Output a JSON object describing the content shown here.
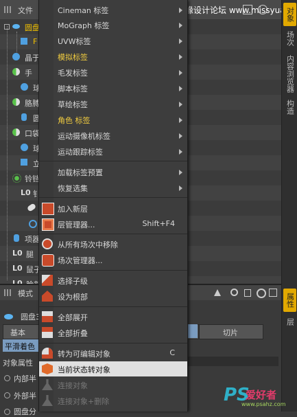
{
  "header": {
    "file_menu": "文件"
  },
  "watermark": {
    "top": "思缘设计论坛 www.missyuan.com",
    "ps": "PS",
    "zh": "爱好者",
    "url": "www.psahz.com"
  },
  "tree": {
    "rows": [
      {
        "label": "圆盘",
        "selected": true
      },
      {
        "label": "F",
        "selected": true
      },
      {
        "label": "晶于",
        "selected": false
      },
      {
        "label": "手",
        "selected": false
      },
      {
        "label": "球",
        "selected": false
      },
      {
        "label": "胳膊",
        "selected": false
      },
      {
        "label": "圆",
        "selected": false
      },
      {
        "label": "口袋",
        "selected": false
      },
      {
        "label": "球",
        "selected": false
      },
      {
        "label": "立",
        "selected": false
      },
      {
        "label": "铃铛",
        "selected": false
      },
      {
        "label": "钅",
        "selected": false
      },
      {
        "label": "",
        "selected": false
      },
      {
        "label": "",
        "selected": false
      },
      {
        "label": "项器",
        "selected": false
      },
      {
        "label": "腿",
        "selected": false
      },
      {
        "label": "鼠子",
        "selected": false
      },
      {
        "label": "脸部",
        "selected": false
      },
      {
        "label": "隐者",
        "selected": false
      }
    ]
  },
  "vtabs": [
    "对象",
    "场次",
    "内容浏览器",
    "构造",
    "属性",
    "层"
  ],
  "attr": {
    "mode": "模式",
    "object_name": "圆盘3",
    "tab_basic": "基本",
    "tab_slice": "切片",
    "smooth_shading": "平滑着色",
    "obj_props": "对象属性",
    "inner": "内部半",
    "outer": "外部半",
    "disc": "圆盘分"
  },
  "menu": {
    "items": [
      {
        "label": "Cineman 标签",
        "submenu": true
      },
      {
        "label": "MoGraph 标签",
        "submenu": true
      },
      {
        "label": "UVW标签",
        "submenu": true
      },
      {
        "label": "模拟标签",
        "submenu": true,
        "yellow": true
      },
      {
        "label": "毛发标签",
        "submenu": true
      },
      {
        "label": "脚本标签",
        "submenu": true
      },
      {
        "label": "草绘标签",
        "submenu": true
      },
      {
        "label": "角色 标签",
        "submenu": true,
        "yellow": true
      },
      {
        "label": "运动摄像机标签",
        "submenu": true
      },
      {
        "label": "运动跟踪标签",
        "submenu": true
      },
      {
        "label": "加载标签预置",
        "submenu": true
      },
      {
        "label": "恢复选集",
        "submenu": true
      },
      {
        "label": "加入新层"
      },
      {
        "label": "层管理器...",
        "shortcut": "Shift+F4"
      },
      {
        "label": "从所有场次中移除"
      },
      {
        "label": "场次管理器..."
      },
      {
        "label": "选择子级"
      },
      {
        "label": "设为根部"
      },
      {
        "label": "全部展开"
      },
      {
        "label": "全部折叠"
      },
      {
        "label": "转为可编辑对象",
        "shortcut": "C"
      },
      {
        "label": "当前状态转对象",
        "highlighted": true
      },
      {
        "label": "连接对象",
        "disabled": true
      },
      {
        "label": "连接对象+删除",
        "disabled": true
      }
    ]
  }
}
